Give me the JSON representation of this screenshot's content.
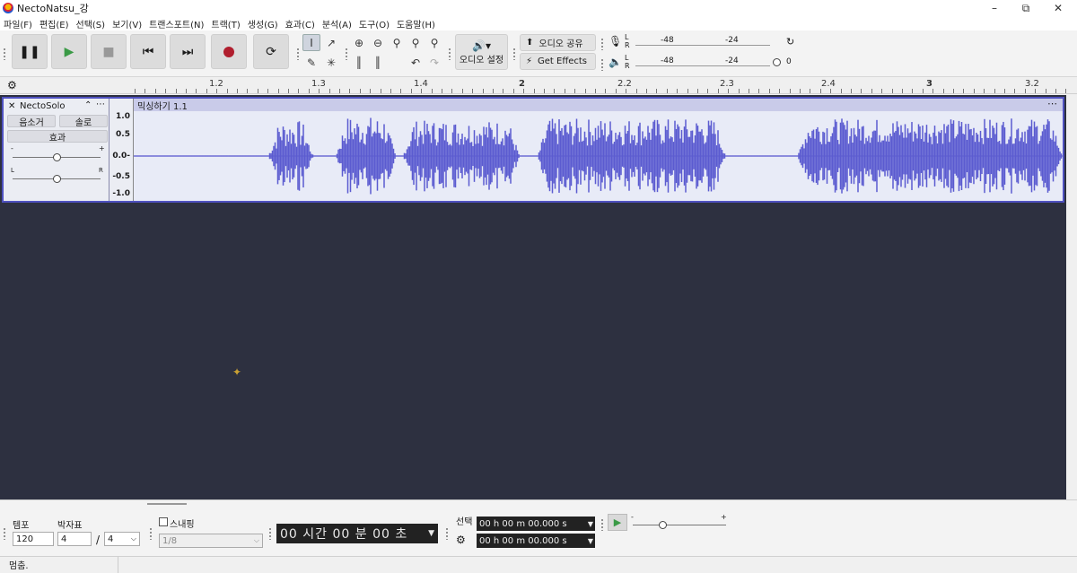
{
  "window": {
    "title": "NectoNatsu_강"
  },
  "menu": [
    "파일(F)",
    "편집(E)",
    "선택(S)",
    "보기(V)",
    "트랜스포트(N)",
    "트랙(T)",
    "생성(G)",
    "효과(C)",
    "분석(A)",
    "도구(O)",
    "도움말(H)"
  ],
  "toolbar": {
    "audio_setup": "오디오 설정",
    "share_audio": "오디오 공유",
    "get_effects": "Get Effects",
    "rec_meter": {
      "L": "L",
      "R": "R",
      "m48": "-48",
      "m24": "-24"
    },
    "play_meter": {
      "L": "L",
      "R": "R",
      "m48": "-48",
      "m24": "-24",
      "zero": "0"
    }
  },
  "timeline": {
    "labels": [
      "1.2",
      "1.3",
      "1.4",
      "2",
      "2.2",
      "2.3",
      "2.4",
      "3",
      "3.2"
    ]
  },
  "track": {
    "name": "NectoSolo",
    "mute": "음소거",
    "solo": "솔로",
    "effects": "효과",
    "gain_minus": "-",
    "gain_plus": "+",
    "pan_l": "L",
    "pan_r": "R",
    "scale": [
      "1.0",
      "0.5",
      "0.0-",
      "-0.5",
      "-1.0"
    ],
    "clip_name": "믹싱하기 1.1"
  },
  "bottom": {
    "tempo_label": "템포",
    "tempo_value": "120",
    "timesig_label": "박자표",
    "timesig_top": "4",
    "timesig_slash": "/",
    "timesig_bottom": "4",
    "snap_label": "스내핑",
    "snap_value": "1/8",
    "time_display": "00 시간 00 분 00 초",
    "selection_label": "선택",
    "sel_start": "00 h 00 m 00.000 s",
    "sel_end": "00 h 00 m 00.000 s",
    "speed_minus": "-",
    "speed_plus": "+"
  },
  "status": {
    "text": "멈춤."
  },
  "colors": {
    "waveform": "#5b5bd0",
    "track_bg": "#2d3040",
    "record": "#b01e2e",
    "play": "#3a9a46"
  }
}
